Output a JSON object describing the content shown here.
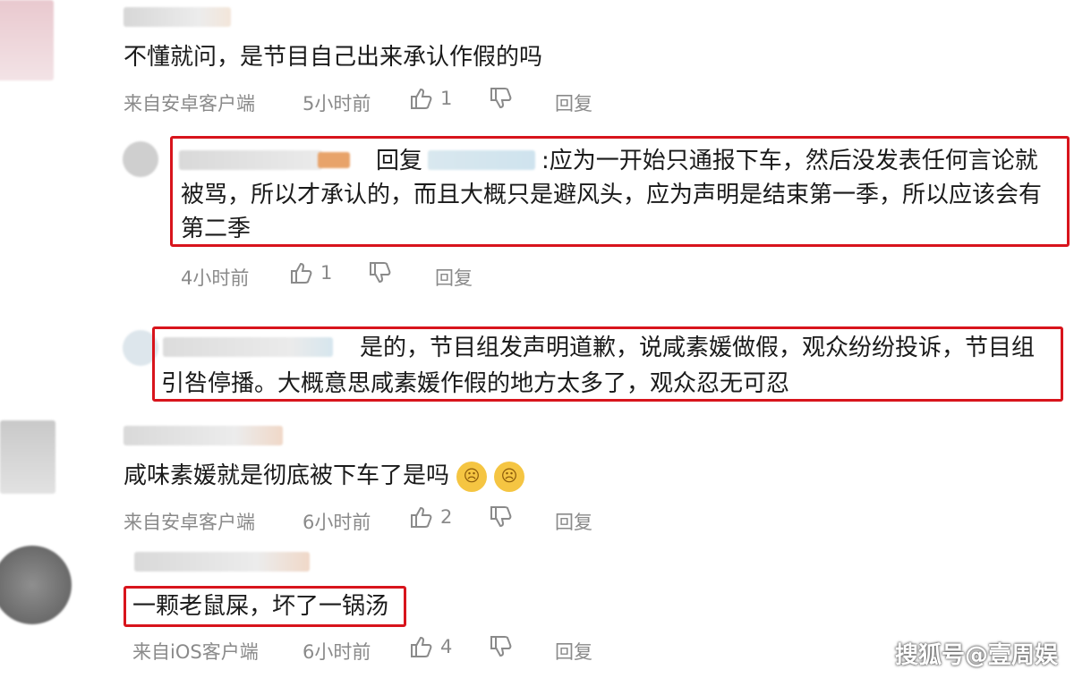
{
  "comment1": {
    "text": "不懂就问，是节目自己出来承认作假的吗",
    "source": "来自安卓客户端",
    "time": "5小时前",
    "likes": "1",
    "reply_label": "回复"
  },
  "reply1": {
    "reply_prefix": "回复",
    "line1": ":应为一开始只通报下车，然后没发表任何言论就",
    "line2": "被骂，所以才承认的，而且大概只是避风头，应为声明是结束第一季，所以应该会有",
    "line3": "第二季",
    "time": "4小时前",
    "likes": "1",
    "reply_label": "回复"
  },
  "reply2": {
    "line1": "是的，节目组发声明道歉，说咸素媛做假，观众纷纷投诉，节目组",
    "line2": "引咎停播。大概意思咸素媛作假的地方太多了，观众忍无可忍"
  },
  "comment2": {
    "text": "咸味素媛就是彻底被下车了是吗",
    "source": "来自安卓客户端",
    "time": "6小时前",
    "likes": "2",
    "reply_label": "回复"
  },
  "comment3": {
    "text": "一颗老鼠屎，坏了一锅汤",
    "source": "来自iOS客户端",
    "time": "6小时前",
    "likes": "4",
    "reply_label": "回复"
  },
  "watermark": "搜狐号@壹周娱"
}
